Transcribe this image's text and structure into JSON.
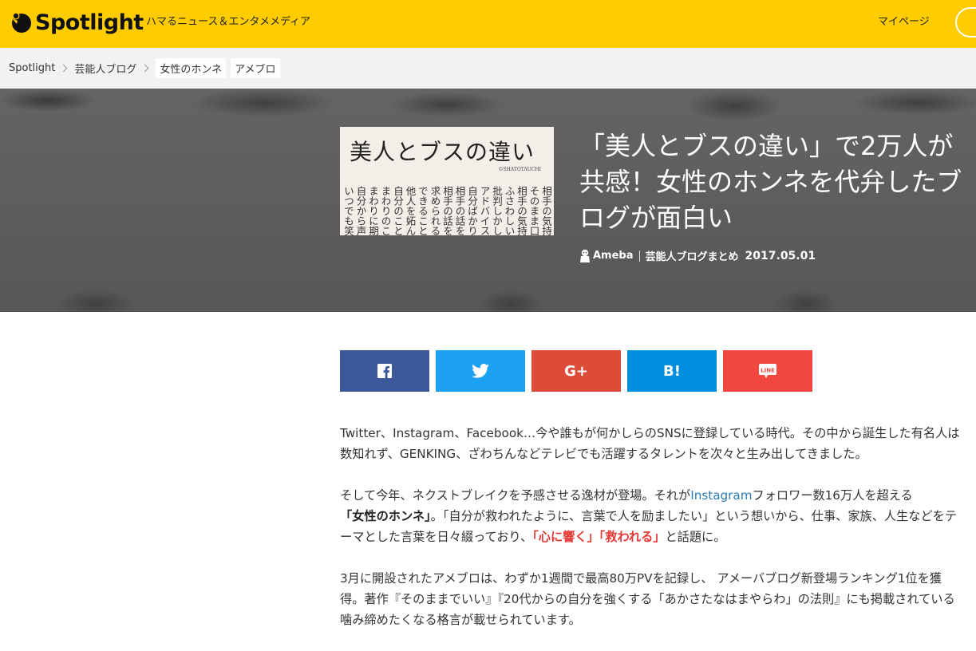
{
  "header": {
    "logo_text": "Spotlight",
    "tagline": "ハマるニュース＆エンタメメディア",
    "mypage_label": "マイページ"
  },
  "breadcrumb": {
    "items": [
      "Spotlight",
      "芸能人ブログ"
    ],
    "tags": [
      "女性のホンネ",
      "アメブロ"
    ]
  },
  "hero": {
    "image": {
      "title": "美人とブスの違い",
      "credit": "©SHATOTAUCHI",
      "lines": [
        "相手の気持ち",
        "そのまま口に",
        "相手の気持ち",
        "ふさわしい言",
        "批判しかしな",
        "アドバイスす",
        "自分ばかり話",
        "相手の話を聞",
        "相手の話を引",
        "求められるこ",
        "できることか",
        "他人を妬んで",
        "自分のことし",
        "まわりのこと",
        "まわりに期待",
        "自分から声を",
        "いつでも笑か"
      ]
    },
    "title": "「美人とブスの違い」で2万人が共感！女性のホンネを代弁したブログが面白い",
    "source": "Ameba",
    "category": "芸能人ブログまとめ",
    "date": "2017.05.01"
  },
  "share": {
    "facebook": "f",
    "twitter": "twitter-bird",
    "gplus": "G+",
    "hatena": "B!",
    "line": "LINE"
  },
  "article": {
    "p1": "Twitter、Instagram、Facebook…今や誰もが何かしらのSNSに登録している時代。その中から誕生した有名人は数知れず、GENKING、ざわちんなどテレビでも活躍するタレントを次々と生み出してきました。",
    "p2": {
      "a": "そして今年、ネクストブレイクを予感させる逸材が登場。それが",
      "link": "Instagram",
      "b": "フォロワー数16万人を超える",
      "strong": "「女性のホンネ」",
      "c": "。「自分が救われたように、言葉で人を励ましたい」という想いから、仕事、家族、人生などをテーマとした言葉を日々綴っており、",
      "red": "「心に響く」「救われる」",
      "d": "と話題に。"
    },
    "p3": "3月に開設されたアメブロは、わずか1週間で最高80万PVを記録し、 アメーバブログ新登場ランキング1位を獲得。著作『そのままでいい』『20代からの自分を強くする「あかさたなはまやらわ」の法則』にも掲載されている噛み締めたくなる格言が載せられています。"
  },
  "colors": {
    "header_bg": "#ffcc00",
    "facebook": "#3b5998",
    "twitter": "#1da1f2",
    "gplus": "#dd4b39",
    "hatena": "#008fde",
    "line": "#f2473f",
    "highlight_red": "#e53935",
    "link_blue": "#2a7bb4"
  }
}
